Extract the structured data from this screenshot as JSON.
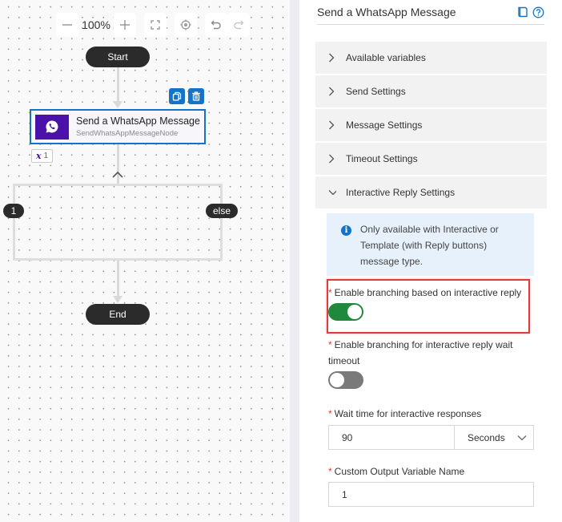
{
  "canvas": {
    "toolbar": {
      "zoom_out_icon": "minus-icon",
      "zoom_level": "100%",
      "zoom_in_icon": "plus-icon",
      "fit_view_icon": "fit-screen-icon",
      "center_icon": "crosshair-icon",
      "undo_icon": "undo-icon",
      "redo_icon": "redo-icon"
    },
    "start_label": "Start",
    "end_label": "End",
    "node": {
      "title": "Send a WhatsApp Message",
      "subtitle": "SendWhatsAppMessageNode",
      "icon": "whatsapp-icon",
      "icon_color": "#4a12a8",
      "border_color": "#1473c8",
      "actions": [
        "copy-icon",
        "delete-icon"
      ],
      "variable_badge": {
        "symbol": "x",
        "count": "1"
      }
    },
    "branches": [
      {
        "label": "1"
      },
      {
        "label": "else"
      }
    ]
  },
  "panel": {
    "title": "Send a WhatsApp Message",
    "header_icons": [
      "book-icon",
      "help-icon"
    ],
    "sections": [
      {
        "label": "Available variables",
        "expanded": false
      },
      {
        "label": "Send Settings",
        "expanded": false
      },
      {
        "label": "Message Settings",
        "expanded": false
      },
      {
        "label": "Timeout Settings",
        "expanded": false
      },
      {
        "label": "Interactive Reply Settings",
        "expanded": true
      }
    ],
    "info_message": "Only available with Interactive or Template (with Reply buttons) message type.",
    "fields": {
      "enable_branching": {
        "label": "Enable branching based on interactive reply",
        "required": "*",
        "value": true
      },
      "enable_timeout_branching": {
        "label": "Enable branching for interactive reply wait timeout",
        "required": "*",
        "value": false
      },
      "wait_time": {
        "label": "Wait time for interactive responses",
        "required": "*",
        "value": "90",
        "unit": "Seconds"
      },
      "output_variable": {
        "label": "Custom Output Variable Name",
        "required": "*",
        "value": "1"
      }
    },
    "colors": {
      "accent": "#1473c8",
      "toggle_on": "#1f8a3e",
      "toggle_off": "#7a7a7a",
      "highlight": "#e0393e",
      "info_bg": "#e6f1fc"
    }
  }
}
